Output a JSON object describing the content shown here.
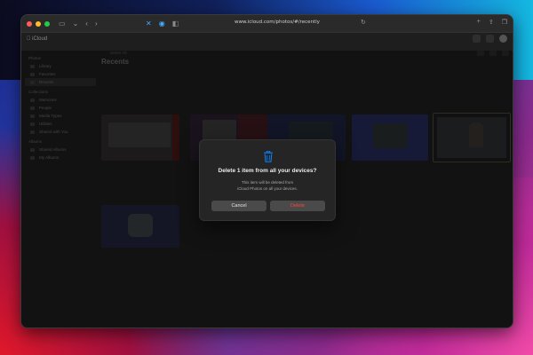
{
  "browser": {
    "url": "www.icloud.com/photos/#/recently",
    "colors": {
      "close": "#ff5f57",
      "minimize": "#febc2e",
      "zoom": "#28c840"
    }
  },
  "app": {
    "brand": "iCloud",
    "sidebar": {
      "sections": [
        {
          "title": "Photos",
          "items": [
            "Library",
            "Favorites",
            "Recents"
          ]
        },
        {
          "title": "Collections",
          "items": [
            "Memories",
            "People",
            "Media Types",
            "Utilities",
            "Shared with You"
          ]
        },
        {
          "title": "Albums",
          "items": [
            "Shared Albums",
            "My Albums"
          ]
        }
      ]
    },
    "main": {
      "title": "Recents",
      "toolbar_label": "Select All"
    }
  },
  "dialog": {
    "icon": "trash-icon",
    "title": "Delete 1 item from all your devices?",
    "message_line1": "This item will be deleted from",
    "message_line2": "iCloud Photos on all your devices.",
    "cancel_label": "Cancel",
    "delete_label": "Delete",
    "accent_color": "#0a84ff",
    "danger_color": "#ff453a"
  }
}
